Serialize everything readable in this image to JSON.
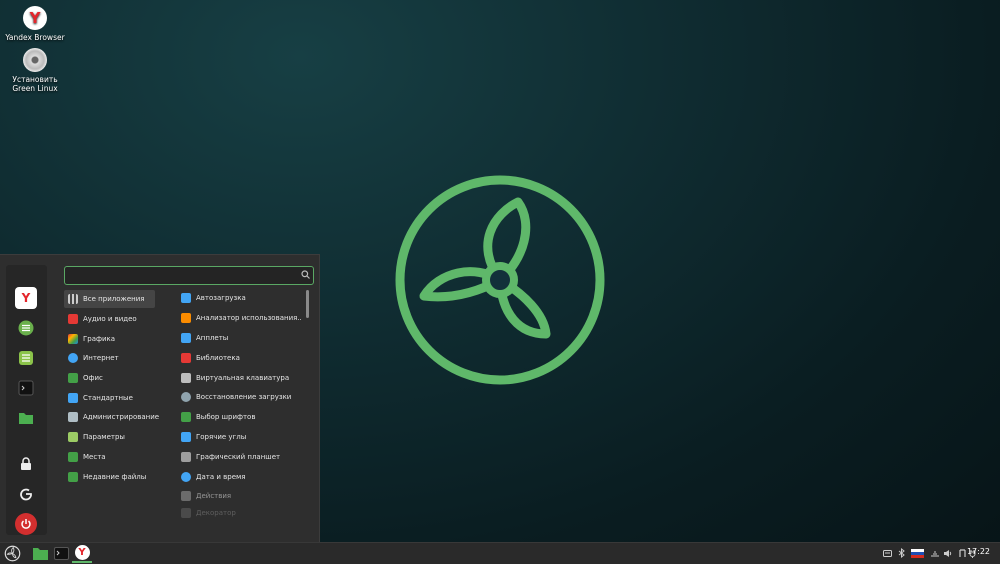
{
  "desktop": {
    "icons": [
      {
        "label": "Yandex Browser"
      },
      {
        "label": "Установить Green Linux"
      }
    ]
  },
  "menu": {
    "search": {
      "value": "",
      "placeholder": ""
    },
    "categories": [
      {
        "label": "Все приложения",
        "icon": "grid-icon",
        "color": "#cccccc"
      },
      {
        "label": "Аудио и видео",
        "icon": "play-icon",
        "color": "#e53935"
      },
      {
        "label": "Графика",
        "icon": "palette-icon",
        "color": "#ffb300"
      },
      {
        "label": "Интернет",
        "icon": "cloud-icon",
        "color": "#42a5f5"
      },
      {
        "label": "Офис",
        "icon": "document-icon",
        "color": "#43a047"
      },
      {
        "label": "Стандартные",
        "icon": "accessories-icon",
        "color": "#42a5f5"
      },
      {
        "label": "Администрирование",
        "icon": "admin-icon",
        "color": "#b0bec5"
      },
      {
        "label": "Параметры",
        "icon": "settings-icon",
        "color": "#9ccc65"
      },
      {
        "label": "Места",
        "icon": "folder-icon",
        "color": "#43a047"
      },
      {
        "label": "Недавние файлы",
        "icon": "folder-icon",
        "color": "#43a047"
      }
    ],
    "apps": [
      {
        "label": "Автозагрузка",
        "color": "#42a5f5"
      },
      {
        "label": "Анализатор использования...",
        "color": "#fb8c00"
      },
      {
        "label": "Апплеты",
        "color": "#42a5f5"
      },
      {
        "label": "Библиотека",
        "color": "#e53935"
      },
      {
        "label": "Виртуальная клавиатура",
        "color": "#bdbdbd"
      },
      {
        "label": "Восстановление загрузки",
        "color": "#90a4ae"
      },
      {
        "label": "Выбор шрифтов",
        "color": "#43a047"
      },
      {
        "label": "Горячие углы",
        "color": "#42a5f5"
      },
      {
        "label": "Графический планшет",
        "color": "#9e9e9e"
      },
      {
        "label": "Дата и время",
        "color": "#42a5f5"
      },
      {
        "label": "Действия",
        "color": "#9e9e9e"
      },
      {
        "label": "Декоратор",
        "color": "#9e9e9e"
      }
    ]
  },
  "panel": {
    "clock": "17:22"
  }
}
